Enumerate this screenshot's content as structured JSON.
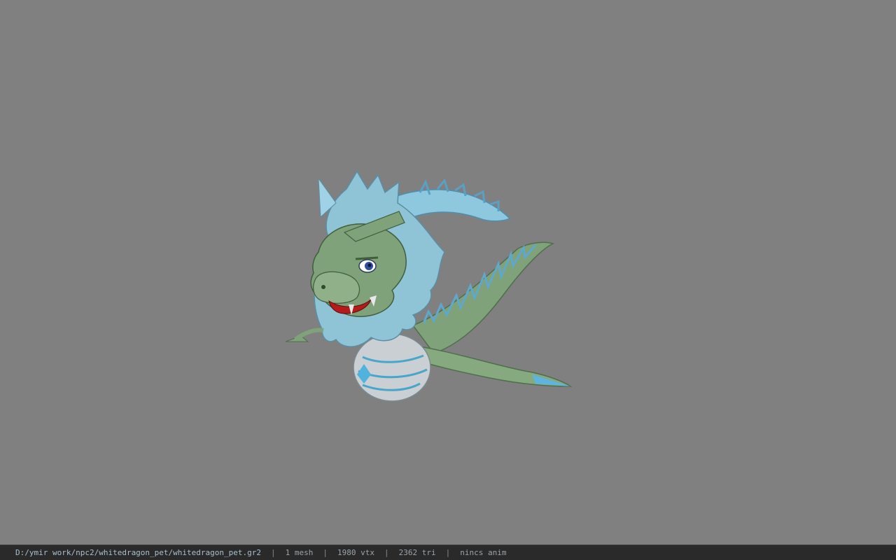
{
  "viewport": {
    "background": "#808080",
    "model": {
      "subject": "white dragon pet 3D model",
      "colors": {
        "scales": "#7fa27a",
        "mane": "#8fc3d6",
        "fins": "#6aaac8",
        "belly": "#c9cfd2",
        "mouth": "#b51b1b"
      }
    }
  },
  "statusbar": {
    "path": "D:/ymir work/npc2/whitedragon_pet/whitedragon_pet.gr2",
    "separator": "|",
    "mesh": "1 mesh",
    "vtx": "1980 vtx",
    "tri": "2362 tri",
    "anim": "nincs anim"
  }
}
